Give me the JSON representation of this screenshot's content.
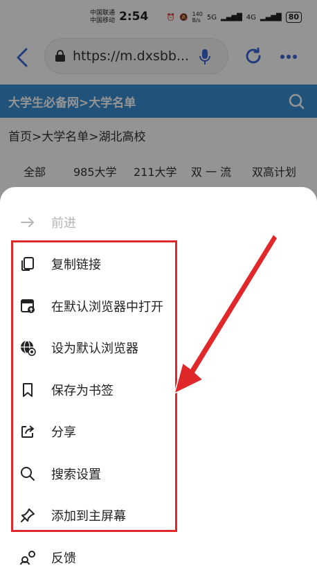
{
  "status_bar": {
    "carrier_1": "中国联通",
    "carrier_2": "中国移动",
    "time": "2:54",
    "net_speed_value": "140",
    "net_speed_unit": "B/s",
    "signal_1": "5G",
    "signal_2": "4G",
    "battery": "80"
  },
  "browser": {
    "url": "https://m.dxsbb...",
    "icons": [
      "back-icon",
      "lock-icon",
      "mic-icon",
      "reload-icon",
      "more-icon"
    ]
  },
  "site": {
    "title": "大学生必备网>大学名单",
    "breadcrumb": "首页>大学名单>湖北高校",
    "tabs": [
      "全部",
      "985大学",
      "211大学",
      "双 一 流",
      "双高计划"
    ]
  },
  "menu": {
    "forward": "前进",
    "items": [
      {
        "label": "复制链接",
        "icon": "copy-icon"
      },
      {
        "label": "在默认浏览器中打开",
        "icon": "open-browser-icon"
      },
      {
        "label": "设为默认浏览器",
        "icon": "globe-icon"
      },
      {
        "label": "保存为书签",
        "icon": "bookmark-icon"
      },
      {
        "label": "分享",
        "icon": "share-icon"
      },
      {
        "label": "搜索设置",
        "icon": "search-icon"
      },
      {
        "label": "添加到主屏幕",
        "icon": "pin-icon"
      }
    ],
    "feedback": "反馈"
  },
  "colors": {
    "accent": "#3a8fd2",
    "annotation": "#e0282a",
    "browser_blue": "#3a67d8"
  }
}
